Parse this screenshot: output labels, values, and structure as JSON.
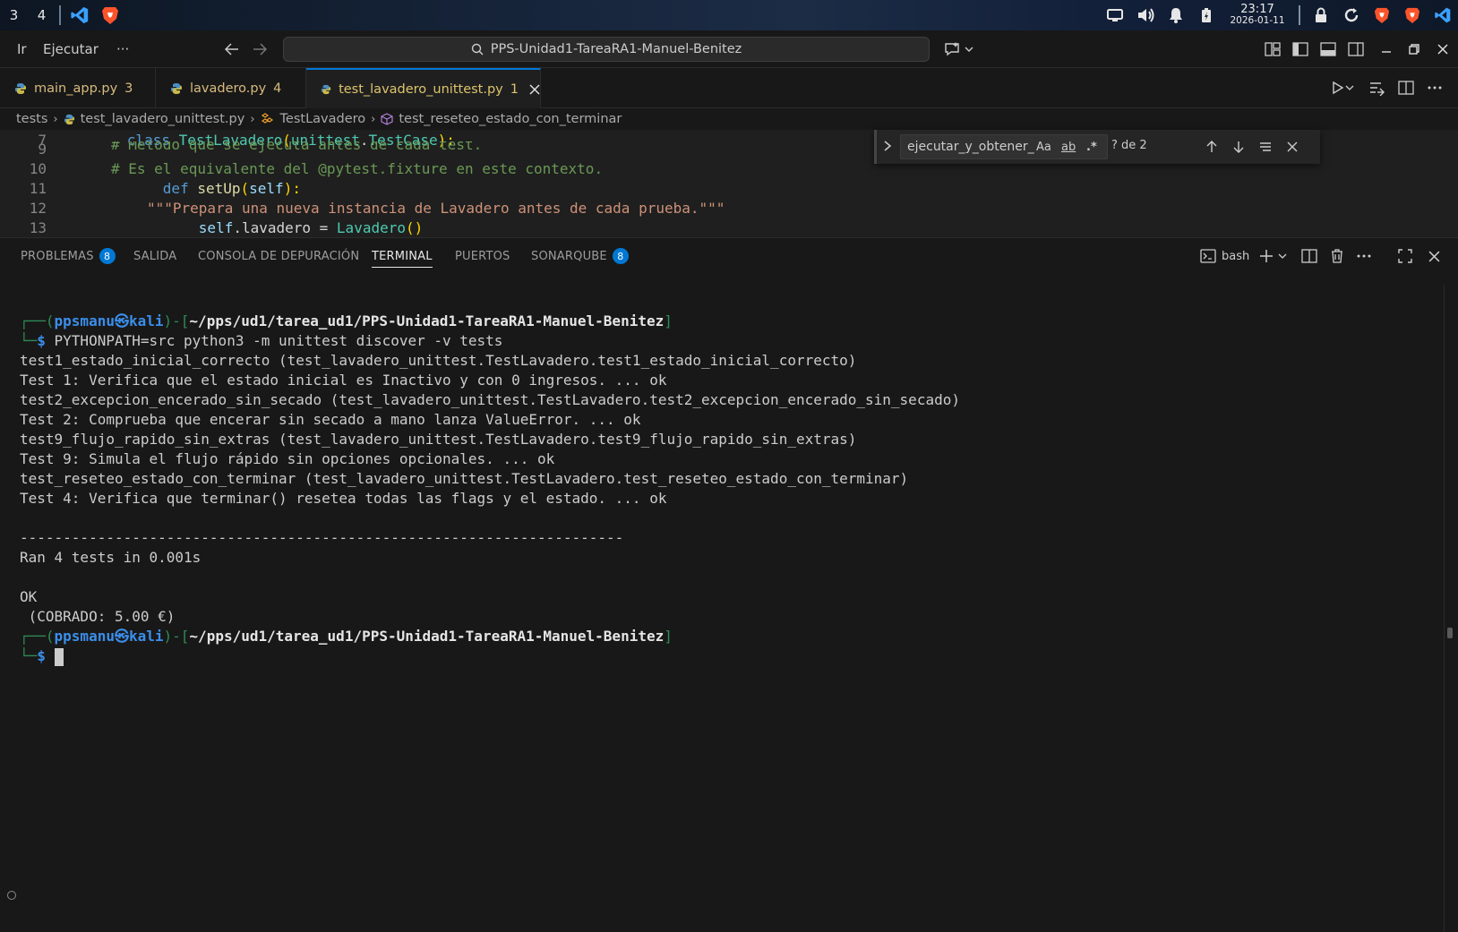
{
  "os_bar": {
    "workspaces": [
      "3",
      "4"
    ],
    "apps": [
      "vscode-icon",
      "brave-icon"
    ],
    "clock_time": "23:17",
    "clock_date": "2026-01-11",
    "tray_icons": [
      "display-icon",
      "volume-icon",
      "bell-icon",
      "battery-icon",
      "lock-icon",
      "refresh-icon",
      "brave-icon",
      "brave-icon",
      "vscode-icon"
    ]
  },
  "titlebar": {
    "menu_go": "Ir",
    "menu_run": "Ejecutar",
    "menu_more": "···",
    "search_text": "PPS-Unidad1-TareaRA1-Manuel-Benitez"
  },
  "tabs": [
    {
      "label": "main_app.py",
      "count": "3"
    },
    {
      "label": "lavadero.py",
      "count": "4"
    },
    {
      "label": "test_lavadero_unittest.py",
      "count": "1",
      "active": true
    }
  ],
  "breadcrumb": {
    "folder": "tests",
    "file": "test_lavadero_unittest.py",
    "class": "TestLavadero",
    "method": "test_reseteo_estado_con_terminar"
  },
  "editor": {
    "lines": [
      {
        "num": "7"
      },
      {
        "num": "9"
      },
      {
        "num": "10"
      },
      {
        "num": "11"
      },
      {
        "num": "12"
      },
      {
        "num": "13"
      }
    ],
    "code": {
      "l7_kw": "class",
      "l7_cls": "TestLavadero",
      "l7_p1": "(",
      "l7_base": "unittest",
      "l7_dot": ".",
      "l7_base2": "TestCase",
      "l7_p2": "):",
      "l9": "# Método que se ejecuta antes de cada test.",
      "l10": "# Es el equivalente del @pytest.fixture en este contexto.",
      "l11_kw": "def",
      "l11_fn": "setUp",
      "l11_p1": "(",
      "l11_prm": "self",
      "l11_p2": "):",
      "l12": "\"\"\"Prepara una nueva instancia de Lavadero antes de cada prueba.\"\"\"",
      "l13_a": "self",
      "l13_b": ".lavadero = ",
      "l13_c": "Lavadero",
      "l13_d": "()"
    }
  },
  "find": {
    "value": "ejecutar_y_obtener_",
    "match_case": "Aa",
    "whole_word": "ab",
    "regex": ".*",
    "count": "? de 2"
  },
  "panel": {
    "tabs": [
      {
        "label": "PROBLEMAS",
        "badge": "8"
      },
      {
        "label": "SALIDA"
      },
      {
        "label": "CONSOLA DE DEPURACIÓN"
      },
      {
        "label": "TERMINAL",
        "active": true
      },
      {
        "label": "PUERTOS"
      },
      {
        "label": "SONARQUBE",
        "badge": "8"
      }
    ],
    "shell": "bash"
  },
  "terminal": {
    "prompt_user": "ppsmanu",
    "prompt_at": "㉿",
    "prompt_host": "kali",
    "prompt_path": "~/pps/ud1/tarea_ud1/PPS-Unidad1-TareaRA1-Manuel-Benitez",
    "command": "PYTHONPATH=src python3 -m unittest discover -v tests",
    "output": [
      "test1_estado_inicial_correcto (test_lavadero_unittest.TestLavadero.test1_estado_inicial_correcto)",
      "Test 1: Verifica que el estado inicial es Inactivo y con 0 ingresos. ... ok",
      "test2_excepcion_encerado_sin_secado (test_lavadero_unittest.TestLavadero.test2_excepcion_encerado_sin_secado)",
      "Test 2: Comprueba que encerar sin secado a mano lanza ValueError. ... ok",
      "test9_flujo_rapido_sin_extras (test_lavadero_unittest.TestLavadero.test9_flujo_rapido_sin_extras)",
      "Test 9: Simula el flujo rápido sin opciones opcionales. ... ok",
      "test_reseteo_estado_con_terminar (test_lavadero_unittest.TestLavadero.test_reseteo_estado_con_terminar)",
      "Test 4: Verifica que terminar() resetea todas las flags y el estado. ... ok",
      "",
      "----------------------------------------------------------------------",
      "Ran 4 tests in 0.001s",
      "",
      "OK",
      " (COBRADO: 5.00 €)"
    ]
  },
  "colors": {
    "accent": "#0078d4",
    "prompt_blue": "#3b8eea",
    "prompt_green": "#2e8b57",
    "warning_yellow": "#d7ba7d"
  }
}
